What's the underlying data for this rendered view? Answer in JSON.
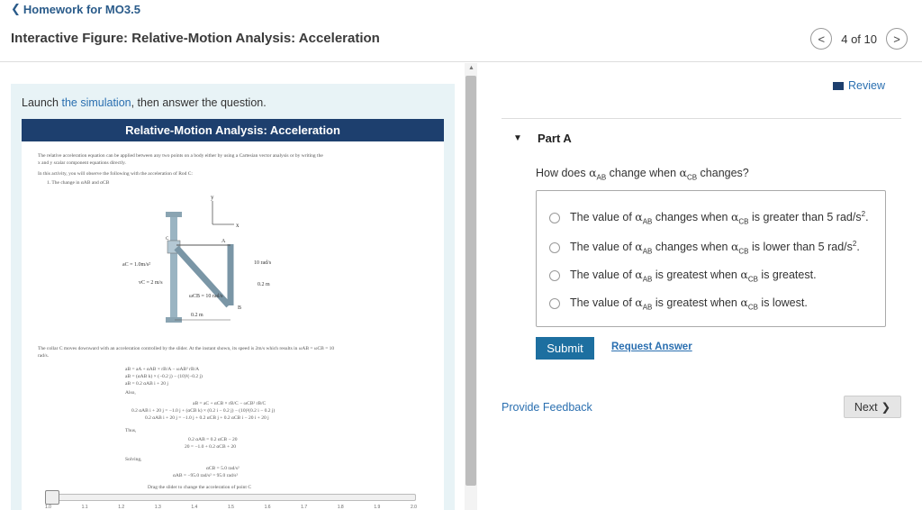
{
  "header": {
    "back_label": "Homework for MO3.5",
    "title": "Interactive Figure: Relative-Motion Analysis: Acceleration",
    "pager_text": "4 of 10"
  },
  "left": {
    "launch_prefix": "Launch ",
    "launch_link": "the simulation",
    "launch_suffix": ", then answer the question.",
    "sim": {
      "title": "Relative-Motion Analysis: Acceleration",
      "intro1": "The relative acceleration equation can be applied between any two points on a body either by using a Cartesian vector analysis or by writing the",
      "intro2": "x and y scalar component equations directly.",
      "intro3": "In this activity, you will observe the following with the acceleration of Rod C:",
      "intro4": "1.  The change in αAB and αCB",
      "ac_label": "aC = 1.0m/s²",
      "vc_label": "vC = 2 m/s",
      "omega_ab": "10 rad/s",
      "dist1": "0.2 m",
      "omega_cb": "ωCB = 10 rad/s",
      "dist2": "0.2 m",
      "axis_y": "y",
      "axis_x": "x",
      "pt_a": "A",
      "pt_b": "B",
      "pt_c": "C",
      "desc": "The collar C moves downward with an acceleration controlled by the slider. At the instant shown, its speed is 2m/s which results in ωAB = ωCB = 10",
      "desc2": "rad/s.",
      "eq1": "aB = aA + αAB × rB/A − ωAB² rB/A",
      "eq2": "aB = (αAB k) × (−0.2 j) − (10)²(−0.2 j)",
      "eq3": "aB = 0.2 αAB i + 20 j",
      "also": "Also,",
      "eq4": "aB = aC + αCB × rB/C − ωCB² rB/C",
      "eq5": "0.2 αAB i + 20 j = −1.0 j + (αCB k) × (0.2 i − 0.2 j) − (10)²(0.2 i − 0.2 j)",
      "eq6": "0.2 αAB i + 20 j = −1.0 j + 0.2 αCB j + 0.2 αCB i − 20 i + 20 j",
      "thus": "Thus,",
      "eq7": "0.2 αAB = 0.2 αCB − 20",
      "eq8": "20 = −1.0 + 0.2 αCB + 20",
      "solving": "Solving,",
      "eq9": "αCB = 5.0 rad/s²",
      "eq10": "αAB = −95.0 rad/s² = 95.0 rad/s²",
      "drag_hint": "Drag the slider to change the acceleration of point C",
      "slider_ticks": [
        "1.0",
        "1.1",
        "1.2",
        "1.3",
        "1.4",
        "1.5",
        "1.6",
        "1.7",
        "1.8",
        "1.9",
        "2.0"
      ]
    }
  },
  "right": {
    "review_label": "Review",
    "part_label": "Part A",
    "question_prefix": "How does ",
    "question_sym1": "α",
    "question_sub1": "AB",
    "question_mid": " change when ",
    "question_sym2": "α",
    "question_sub2": "CB",
    "question_suffix": " changes?",
    "options": [
      {
        "pre": "The value of ",
        "s1": "α",
        "sub1": "AB",
        "mid": " changes when ",
        "s2": "α",
        "sub2": "CB",
        "post": " is greater than 5 rad/s",
        "sup": "2",
        "end": "."
      },
      {
        "pre": "The value of ",
        "s1": "α",
        "sub1": "AB",
        "mid": " changes when ",
        "s2": "α",
        "sub2": "CB",
        "post": " is lower than 5 rad/s",
        "sup": "2",
        "end": "."
      },
      {
        "pre": "The value of ",
        "s1": "α",
        "sub1": "AB",
        "mid": " is greatest when ",
        "s2": "α",
        "sub2": "CB",
        "post": " is greatest.",
        "sup": "",
        "end": ""
      },
      {
        "pre": "The value of ",
        "s1": "α",
        "sub1": "AB",
        "mid": " is greatest when ",
        "s2": "α",
        "sub2": "CB",
        "post": " is lowest.",
        "sup": "",
        "end": ""
      }
    ],
    "submit_label": "Submit",
    "request_label": "Request Answer",
    "feedback_label": "Provide Feedback",
    "next_label": "Next"
  },
  "colors": {
    "link": "#2a6fb0",
    "sim_header": "#1d3f6e",
    "submit": "#1d6fa0",
    "panel_bg": "#e8f3f6"
  }
}
